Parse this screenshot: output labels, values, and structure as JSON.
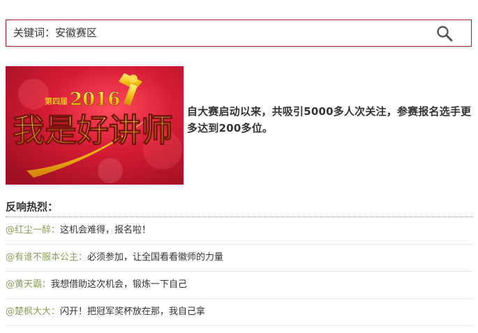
{
  "search": {
    "value": "关键词：安徽赛区",
    "icon": "search-icon"
  },
  "banner": {
    "edition": "第四届",
    "year": "2016",
    "title": "我是好讲师",
    "colors": {
      "background": "#c8102e",
      "text": "#f5c518"
    }
  },
  "intro": {
    "text": "自大赛启动以来，共吸引5000多人次关注，参赛报名选手更多达到200多位。"
  },
  "section": {
    "title": "反响热烈："
  },
  "comments": [
    {
      "user": "@红尘一醉：",
      "text": "这机会难得，报名啦！"
    },
    {
      "user": "@有谁不服本公主：",
      "text": "必须参加，让全国看看徽师的力量"
    },
    {
      "user": "@黄天霸：",
      "text": "我想借助这次机会，锻炼一下自己"
    },
    {
      "user": "@楚枫大大：",
      "text": "闪开！把冠军奖杯放在那，我自己拿"
    }
  ],
  "colors": {
    "accent": "#a0282a",
    "username": "#8aa05a"
  }
}
